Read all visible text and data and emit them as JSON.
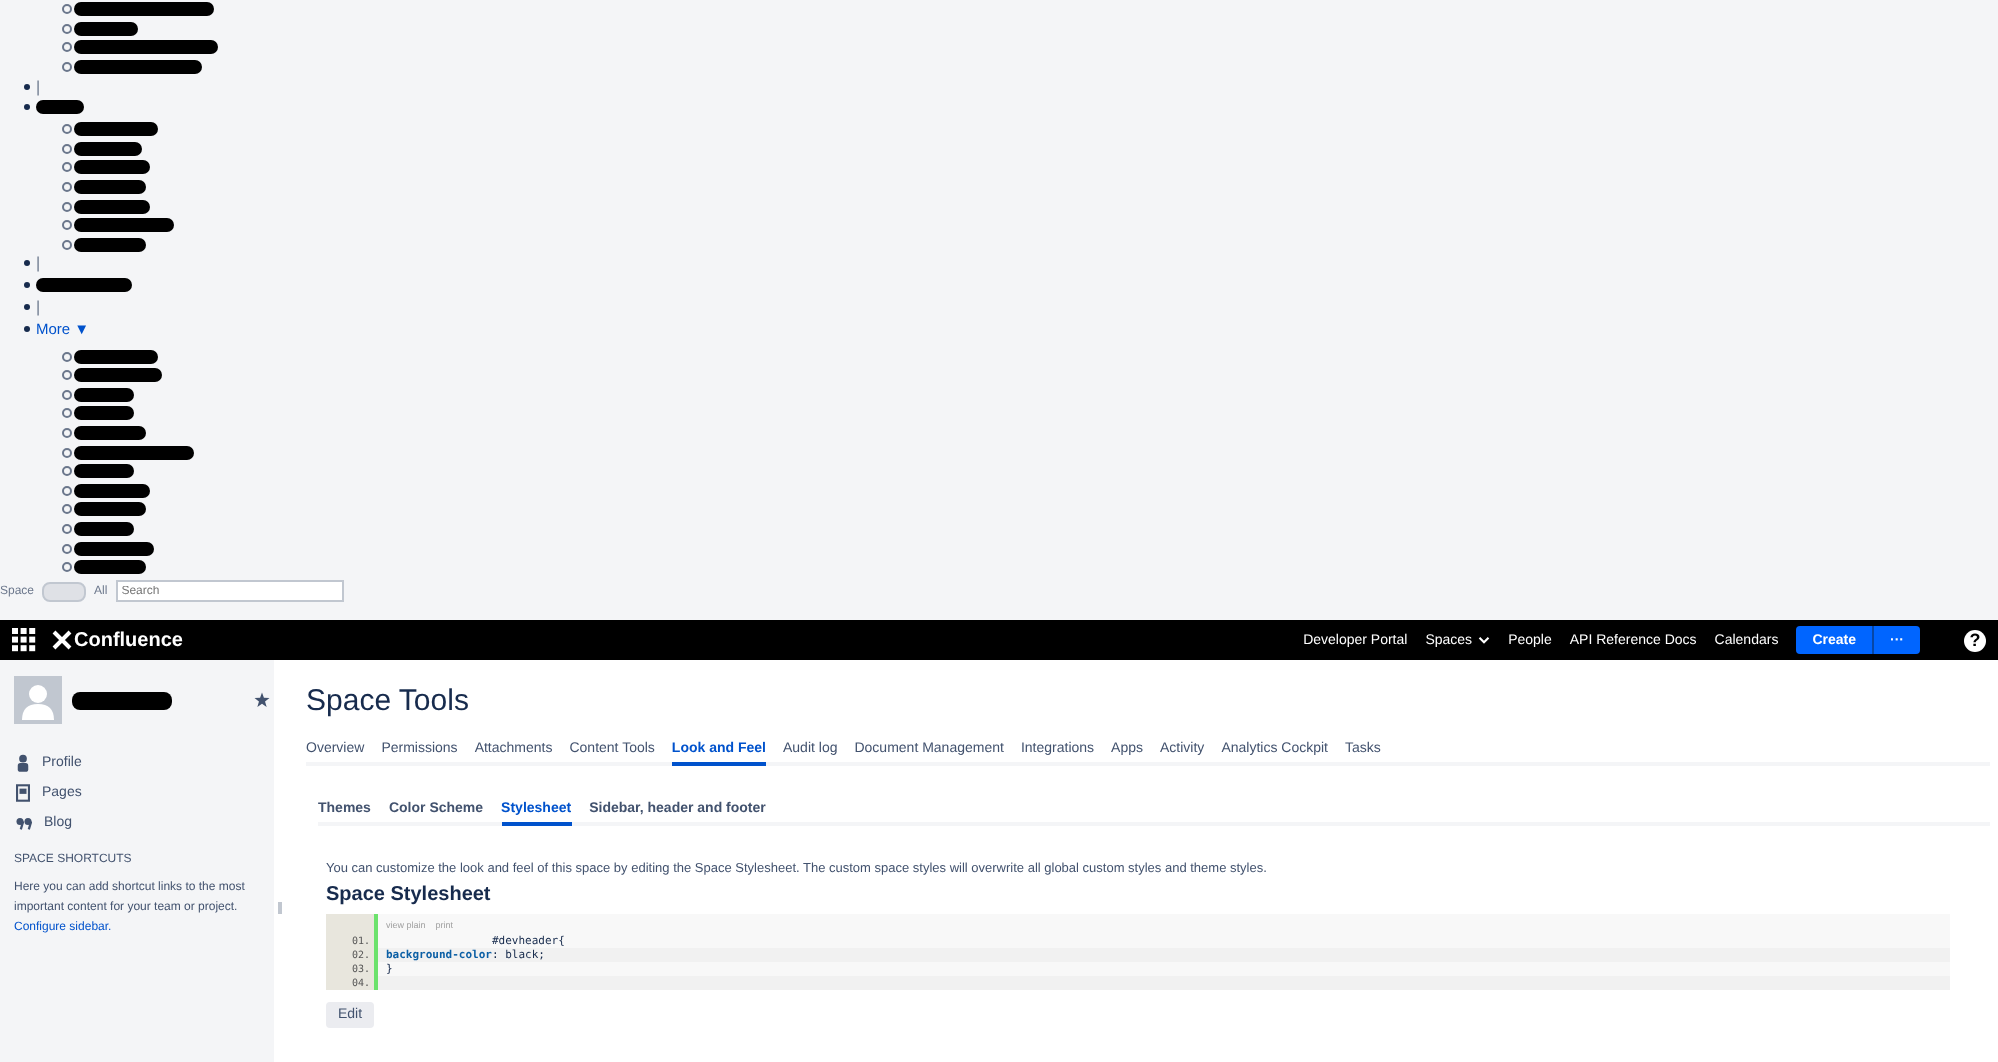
{
  "broken_menu": {
    "entries": [
      {
        "kind": "subitem"
      },
      {
        "kind": "subitem"
      },
      {
        "kind": "subitem"
      },
      {
        "kind": "subitem"
      },
      {
        "kind": "separator",
        "label": "|"
      },
      {
        "kind": "redacted"
      },
      {
        "kind": "subitem"
      },
      {
        "kind": "subitem"
      },
      {
        "kind": "subitem"
      },
      {
        "kind": "subitem"
      },
      {
        "kind": "subitem"
      },
      {
        "kind": "subitem"
      },
      {
        "kind": "subitem"
      },
      {
        "kind": "separator",
        "label": "|"
      },
      {
        "kind": "redacted"
      },
      {
        "kind": "separator",
        "label": "|"
      },
      {
        "kind": "link",
        "label": "More ▼"
      },
      {
        "kind": "subitem"
      },
      {
        "kind": "subitem"
      },
      {
        "kind": "subitem"
      },
      {
        "kind": "subitem"
      },
      {
        "kind": "subitem"
      },
      {
        "kind": "subitem"
      },
      {
        "kind": "subitem"
      },
      {
        "kind": "subitem"
      },
      {
        "kind": "subitem"
      },
      {
        "kind": "subitem"
      },
      {
        "kind": "subitem"
      },
      {
        "kind": "subitem"
      }
    ],
    "search_row": {
      "label": "Space",
      "toggle_on": false,
      "toggle_label": "All",
      "search": {
        "placeholder": "Search"
      }
    }
  },
  "header": {
    "logo": "Confluence",
    "nav": [
      {
        "label": "Developer Portal",
        "dropdown": false
      },
      {
        "label": "Spaces",
        "dropdown": true
      },
      {
        "label": "People",
        "dropdown": false
      },
      {
        "label": "API Reference Docs",
        "dropdown": false
      },
      {
        "label": "Calendars",
        "dropdown": false
      }
    ],
    "create": "Create",
    "more": "···",
    "help": "?"
  },
  "sidebar": {
    "items": [
      {
        "label": "Profile"
      },
      {
        "label": "Pages"
      },
      {
        "label": "Blog"
      }
    ],
    "shortcuts_title": "SPACE SHORTCUTS",
    "shortcuts_text": "Here you can add shortcut links to the most important content for your team or project.",
    "configure_link": "Configure sidebar."
  },
  "main": {
    "title": "Space Tools",
    "tabs": [
      {
        "label": "Overview",
        "selected": false
      },
      {
        "label": "Permissions",
        "selected": false
      },
      {
        "label": "Attachments",
        "selected": false
      },
      {
        "label": "Content Tools",
        "selected": false
      },
      {
        "label": "Look and Feel",
        "selected": true
      },
      {
        "label": "Audit log",
        "selected": false
      },
      {
        "label": "Document Management",
        "selected": false
      },
      {
        "label": "Integrations",
        "selected": false
      },
      {
        "label": "Apps",
        "selected": false
      },
      {
        "label": "Activity",
        "selected": false
      },
      {
        "label": "Analytics Cockpit",
        "selected": false
      },
      {
        "label": "Tasks",
        "selected": false
      }
    ],
    "subtabs": [
      {
        "label": "Themes",
        "selected": false
      },
      {
        "label": "Color Scheme",
        "selected": false
      },
      {
        "label": "Stylesheet",
        "selected": true
      },
      {
        "label": "Sidebar, header and footer",
        "selected": false
      }
    ],
    "description": "You can customize the look and feel of this space by editing the Space Stylesheet. The custom space styles will overwrite all global custom styles and theme styles.",
    "heading": "Space Stylesheet",
    "code": {
      "toolbar": [
        "view plain",
        "print"
      ],
      "lines": [
        {
          "number": "01.",
          "tokens": [
            {
              "kind": "plain",
              "text": "                #devheader{"
            }
          ]
        },
        {
          "number": "02.",
          "tokens": [
            {
              "kind": "property",
              "text": "background-color"
            },
            {
              "kind": "plain",
              "text": ": black;"
            }
          ]
        },
        {
          "number": "03.",
          "tokens": [
            {
              "kind": "plain",
              "text": "}"
            }
          ]
        },
        {
          "number": "04."
        }
      ]
    },
    "edit_button": "Edit"
  }
}
